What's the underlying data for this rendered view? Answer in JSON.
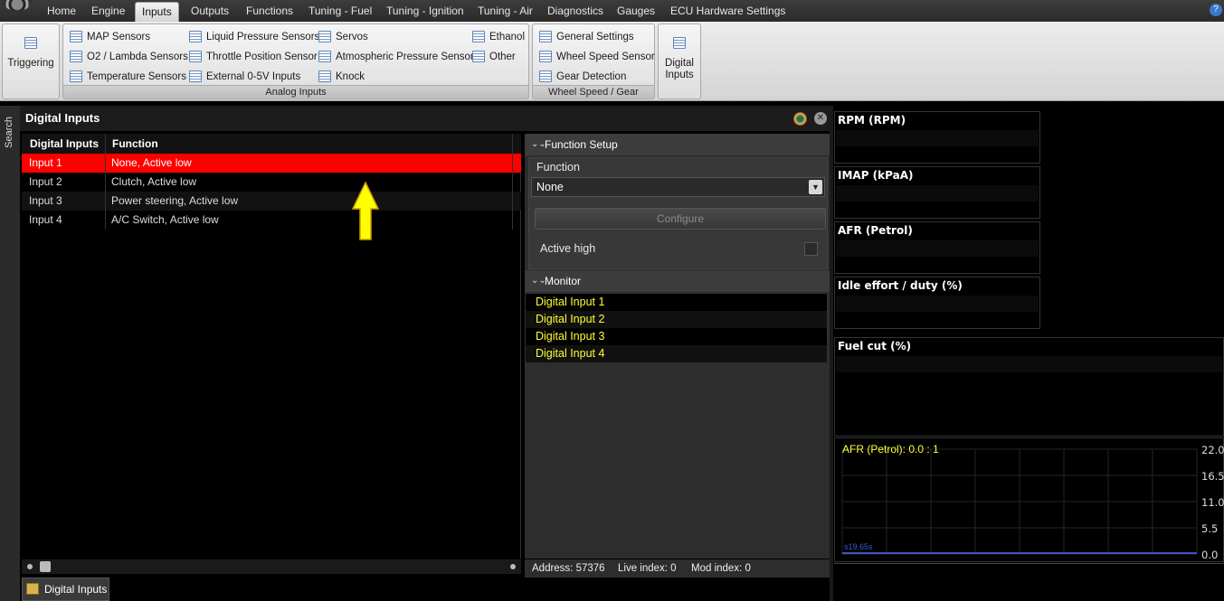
{
  "menu": {
    "tabs": [
      {
        "label": "Home"
      },
      {
        "label": "Engine"
      },
      {
        "label": "Inputs"
      },
      {
        "label": "Outputs"
      },
      {
        "label": "Functions"
      },
      {
        "label": "Tuning - Fuel"
      },
      {
        "label": "Tuning - Ignition"
      },
      {
        "label": "Tuning - Air"
      },
      {
        "label": "Diagnostics"
      },
      {
        "label": "Gauges"
      },
      {
        "label": "ECU Hardware Settings"
      }
    ],
    "active_tab": "Inputs",
    "help": "?"
  },
  "ribbon": {
    "triggering": "Triggering",
    "analog": {
      "items": [
        "MAP Sensors",
        "O2 / Lambda Sensors",
        "Temperature Sensors",
        "Liquid Pressure Sensors",
        "Throttle Position Sensor",
        "External 0-5V Inputs",
        "Servos",
        "Atmospheric Pressure Sensor",
        "Knock",
        "Ethanol",
        "Other"
      ],
      "label": "Analog Inputs"
    },
    "wheel": {
      "items": [
        "General Settings",
        "Wheel Speed Sensor",
        "Gear Detection"
      ],
      "label": "Wheel Speed / Gear"
    },
    "digital_line1": "Digital",
    "digital_line2": "Inputs"
  },
  "sidebar": {
    "search": "Search"
  },
  "panel": {
    "title": "Digital Inputs"
  },
  "grid": {
    "headers": [
      "Digital Inputs",
      "Function"
    ],
    "rows": [
      {
        "input": "Input 1",
        "function": "None, Active low"
      },
      {
        "input": "Input 2",
        "function": "Clutch, Active low"
      },
      {
        "input": "Input 3",
        "function": "Power steering, Active low"
      },
      {
        "input": "Input 4",
        "function": "A/C Switch, Active low"
      }
    ],
    "selected_row": 0
  },
  "function_setup": {
    "header": "Function Setup",
    "function_label": "Function",
    "function_value": "None",
    "configure": "Configure",
    "active_high_label": "Active high",
    "active_high": false
  },
  "monitor": {
    "header": "Monitor",
    "items": [
      "Digital Input 1",
      "Digital Input 2",
      "Digital Input 3",
      "Digital Input 4"
    ]
  },
  "status": {
    "address": "Address: 57376",
    "live_index": "Live index: 0",
    "mod_index": "Mod index: 0"
  },
  "doc_tab": {
    "label": "Digital Inputs"
  },
  "gauges": [
    {
      "title": "RPM (RPM)"
    },
    {
      "title": "IMAP  (kPaA)"
    },
    {
      "title": "AFR (Petrol)"
    },
    {
      "title": "Idle effort / duty (%)"
    },
    {
      "title": "Fuel cut (%)"
    }
  ],
  "chart": {
    "title": "AFR (Petrol):  0.0 : 1",
    "time_label": "s19.65s",
    "y_ticks": [
      "22.0",
      "16.5",
      "11.0",
      "5.5",
      "0.0"
    ]
  },
  "chart_data": {
    "type": "line",
    "title": "AFR (Petrol):  0.0 : 1",
    "xlabel": "",
    "ylabel": "",
    "ylim": [
      0,
      22
    ],
    "y_ticks": [
      22.0,
      16.5,
      11.0,
      5.5,
      0.0
    ],
    "series": [
      {
        "name": "AFR (Petrol)",
        "values": [
          0.0,
          0.0
        ]
      }
    ],
    "grid": true
  },
  "colors": {
    "selection": "#ff0000",
    "monitor_text": "#ffff33",
    "chart_title": "#ffff33",
    "series_line": "#4a6cff",
    "arrow_fill": "#ffff00"
  }
}
